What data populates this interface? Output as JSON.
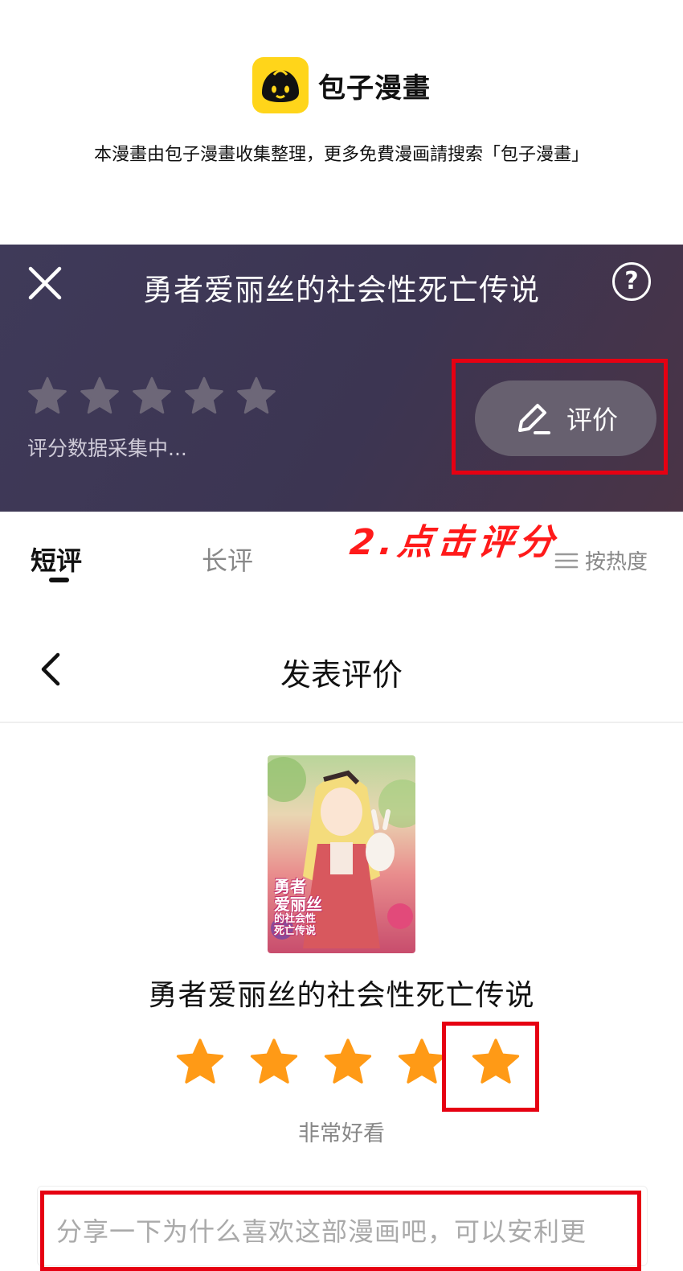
{
  "brand": {
    "name": "包子漫畫",
    "note": "本漫畫由包子漫畫收集整理，更多免費漫画請搜索「包子漫畫」"
  },
  "header": {
    "title": "勇者爱丽丝的社会性死亡传说",
    "help_label": "?",
    "rating_status": "评分数据采集中...",
    "rate_button_label": "评价",
    "rating_stars": 0
  },
  "annotation": "2.点击评分",
  "tabs": {
    "short": "短评",
    "long": "长评",
    "sort": "按热度"
  },
  "publish": {
    "title": "发表评价",
    "comic_title": "勇者爱丽丝的社会性死亡传说",
    "cover_text": [
      "勇者",
      "爱丽丝",
      "的社会性",
      "死亡传说"
    ],
    "selected_stars": 5,
    "max_stars": 5,
    "rating_label": "非常好看",
    "comment_placeholder": "分享一下为什么喜欢这部漫画吧，可以安利更"
  },
  "colors": {
    "header_bg": "#3e3755",
    "star_active": "#ff9a16",
    "star_inactive": "#6d6778",
    "highlight": "#e60012",
    "annotation": "#ff1a1a"
  }
}
